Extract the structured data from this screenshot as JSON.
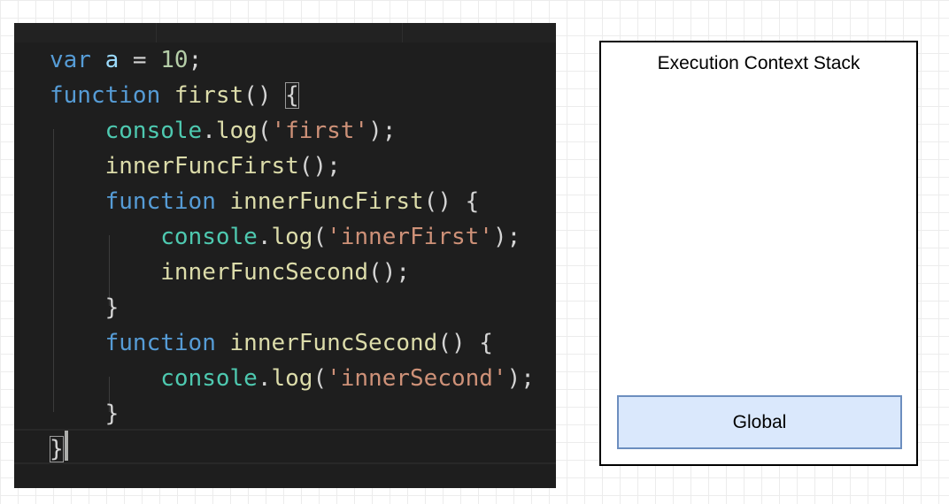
{
  "code": {
    "lines": [
      [
        {
          "t": "var",
          "c": "kw"
        },
        {
          "t": " ",
          "c": "pun"
        },
        {
          "t": "a",
          "c": "var"
        },
        {
          "t": " = ",
          "c": "pun"
        },
        {
          "t": "10",
          "c": "num"
        },
        {
          "t": ";",
          "c": "pun"
        }
      ],
      [
        {
          "t": "function",
          "c": "kw"
        },
        {
          "t": " ",
          "c": "pun"
        },
        {
          "t": "first",
          "c": "fn"
        },
        {
          "t": "() ",
          "c": "pun"
        },
        {
          "t": "{",
          "c": "pun",
          "box": true
        }
      ],
      [
        {
          "t": "    ",
          "c": "pun"
        },
        {
          "t": "console",
          "c": "obj"
        },
        {
          "t": ".",
          "c": "pun"
        },
        {
          "t": "log",
          "c": "fn"
        },
        {
          "t": "(",
          "c": "pun"
        },
        {
          "t": "'first'",
          "c": "str"
        },
        {
          "t": ");",
          "c": "pun"
        }
      ],
      [
        {
          "t": "    ",
          "c": "pun"
        },
        {
          "t": "innerFuncFirst",
          "c": "fn"
        },
        {
          "t": "();",
          "c": "pun"
        }
      ],
      [
        {
          "t": "    ",
          "c": "pun"
        },
        {
          "t": "function",
          "c": "kw"
        },
        {
          "t": " ",
          "c": "pun"
        },
        {
          "t": "innerFuncFirst",
          "c": "fn"
        },
        {
          "t": "() {",
          "c": "pun"
        }
      ],
      [
        {
          "t": "        ",
          "c": "pun"
        },
        {
          "t": "console",
          "c": "obj"
        },
        {
          "t": ".",
          "c": "pun"
        },
        {
          "t": "log",
          "c": "fn"
        },
        {
          "t": "(",
          "c": "pun"
        },
        {
          "t": "'innerFirst'",
          "c": "str"
        },
        {
          "t": ");",
          "c": "pun"
        }
      ],
      [
        {
          "t": "        ",
          "c": "pun"
        },
        {
          "t": "innerFuncSecond",
          "c": "fn"
        },
        {
          "t": "();",
          "c": "pun"
        }
      ],
      [
        {
          "t": "    }",
          "c": "pun"
        }
      ],
      [
        {
          "t": "    ",
          "c": "pun"
        },
        {
          "t": "function",
          "c": "kw"
        },
        {
          "t": " ",
          "c": "pun"
        },
        {
          "t": "innerFuncSecond",
          "c": "fn"
        },
        {
          "t": "() {",
          "c": "pun"
        }
      ],
      [
        {
          "t": "        ",
          "c": "pun"
        },
        {
          "t": "console",
          "c": "obj"
        },
        {
          "t": ".",
          "c": "pun"
        },
        {
          "t": "log",
          "c": "fn"
        },
        {
          "t": "(",
          "c": "pun"
        },
        {
          "t": "'innerSecond'",
          "c": "str"
        },
        {
          "t": ");",
          "c": "pun"
        }
      ],
      [
        {
          "t": "    }",
          "c": "pun"
        }
      ],
      [
        {
          "t": "}",
          "c": "pun",
          "box": true
        }
      ]
    ]
  },
  "stack": {
    "title": "Execution Context Stack",
    "frames": [
      {
        "label": "Global"
      }
    ]
  },
  "colors": {
    "editor_bg": "#1e1e1e",
    "keyword": "#569cd6",
    "function_name": "#dcdcaa",
    "object": "#4ec9b0",
    "string": "#ce9178",
    "number": "#b5cea8",
    "frame_fill": "#dae8fc",
    "frame_border": "#6c8ebf"
  }
}
